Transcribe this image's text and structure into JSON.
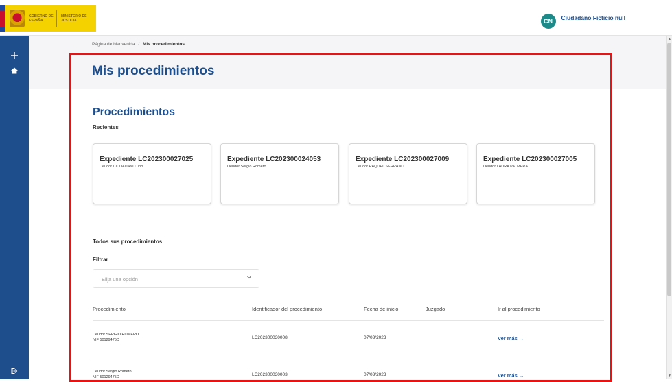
{
  "header": {
    "gov_text": "GOBIERNO DE ESPAÑA",
    "ministry_text": "MINISTERIO DE JUSTICIA",
    "avatar_initials": "CN",
    "user_name": "Ciudadano Ficticio null"
  },
  "sidebar": {
    "add_icon": "plus-icon",
    "home_icon": "home-icon",
    "logout_icon": "logout-icon"
  },
  "breadcrumb": {
    "home": "Página de bienvenida",
    "separator": "/",
    "current": "Mis procedimientos"
  },
  "page": {
    "title": "Mis procedimientos",
    "section_title": "Procedimientos",
    "recent_label": "Recientes",
    "all_label": "Todos sus procedimientos",
    "filter_label": "Filtrar",
    "filter_placeholder": "Elija una opción"
  },
  "recent_cards": [
    {
      "title": "Expediente LC202300027025",
      "debtor": "Deudor CIUDADANO uno"
    },
    {
      "title": "Expediente LC202300024053",
      "debtor": "Deudor Sergio Romero"
    },
    {
      "title": "Expediente LC202300027009",
      "debtor": "Deudor RAQUEL SERRANO"
    },
    {
      "title": "Expediente LC202300027005",
      "debtor": "Deudor LAURA PALMERA"
    }
  ],
  "table": {
    "headers": [
      "Procedimiento",
      "Identificador del procedimiento",
      "Fecha de inicio",
      "Juzgado",
      "Ir al procedimiento"
    ],
    "rows": [
      {
        "debtor": "Deudor SERGIO ROMERO",
        "nif": "NIF 50129475D",
        "id": "LC202300030008",
        "date": "07/03/2023",
        "court": "",
        "link": "Ver más →"
      },
      {
        "debtor": "Deudor Sergio Romero",
        "nif": "NIF 50129475D",
        "id": "LC202300030003",
        "date": "07/03/2023",
        "court": "",
        "link": "Ver más →"
      }
    ]
  },
  "colors": {
    "primary": "#1c4f8f",
    "sidebar": "#1e4e8c",
    "highlight": "#ee1111",
    "avatar": "#1d8a8a"
  }
}
